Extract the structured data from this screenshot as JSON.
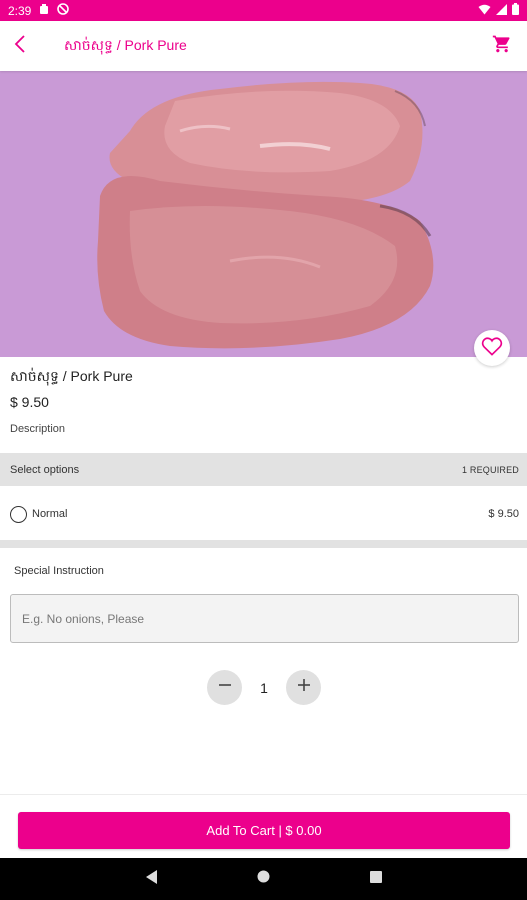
{
  "status_bar": {
    "time": "2:39"
  },
  "app_bar": {
    "title": "សាច់សុទ្ធ / Pork Pure"
  },
  "product": {
    "name": "សាច់សុទ្ធ / Pork Pure",
    "price": "$ 9.50",
    "description_label": "Description",
    "image": "pork-pure-photo"
  },
  "options": {
    "header": "Select options",
    "required": "1 REQUIRED",
    "items": [
      {
        "label": "Normal",
        "price": "$ 9.50",
        "selected": false
      }
    ]
  },
  "special_instruction": {
    "label": "Special Instruction",
    "placeholder": "E.g. No onions, Please",
    "value": ""
  },
  "quantity": {
    "value": "1"
  },
  "add_to_cart": {
    "label": "Add To Cart | $ 0.00"
  },
  "colors": {
    "brand": "#ec008c",
    "hero_background": "#c99ad6",
    "section_background": "#e2e2e2"
  }
}
